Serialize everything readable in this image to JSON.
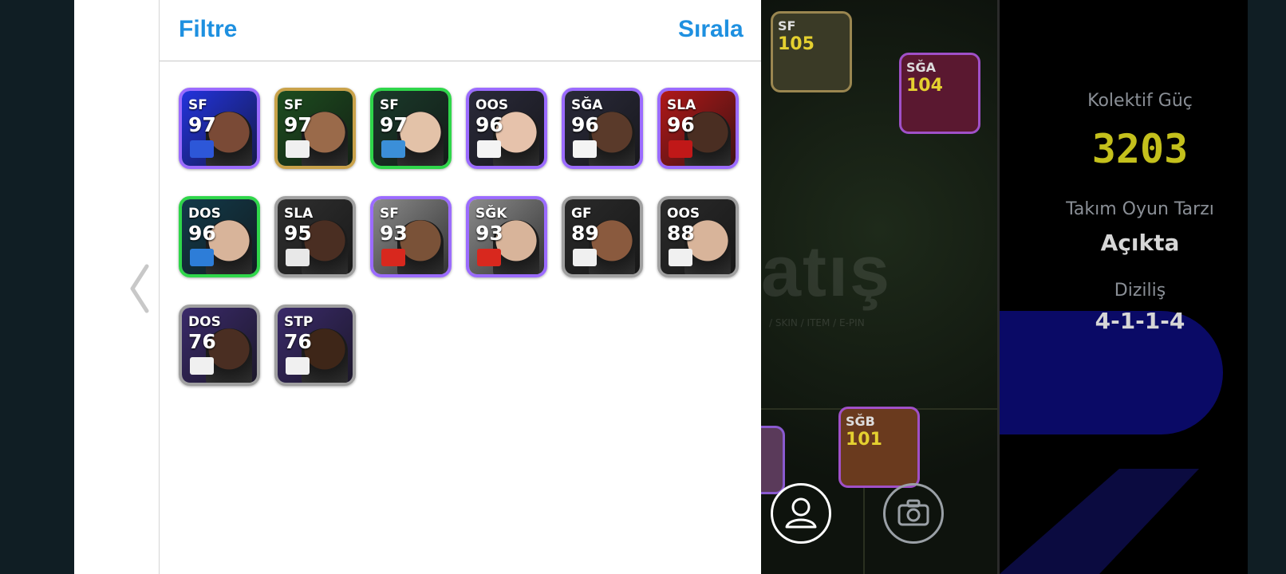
{
  "header": {
    "filter_label": "Filtre",
    "sort_label": "Sırala"
  },
  "cards": [
    {
      "pos": "SF",
      "rating": "97",
      "border": "#9b6bff",
      "bg": "#2233dd",
      "skin": "#7a4a36",
      "badge": "#2d57d8"
    },
    {
      "pos": "SF",
      "rating": "97",
      "border": "#c9a24a",
      "bg": "#1d4d1f",
      "skin": "#9a6a4a",
      "badge": "#f0f0f0"
    },
    {
      "pos": "SF",
      "rating": "97",
      "border": "#2fd64a",
      "bg": "#1a3a2a",
      "skin": "#e3c2a8",
      "badge": "#3b8fd8"
    },
    {
      "pos": "OOS",
      "rating": "96",
      "border": "#9b6bff",
      "bg": "#2a2a3a",
      "skin": "#e6c2ab",
      "badge": "#f4f4f4"
    },
    {
      "pos": "SĞA",
      "rating": "96",
      "border": "#9b6bff",
      "bg": "#2a2a3a",
      "skin": "#5a3a2a",
      "badge": "#f4f4f4"
    },
    {
      "pos": "SLA",
      "rating": "96",
      "border": "#9b6bff",
      "bg": "#b01818",
      "skin": "#4a2e22",
      "badge": "#c01818"
    },
    {
      "pos": "DOS",
      "rating": "96",
      "border": "#2fd64a",
      "bg": "#123a4a",
      "skin": "#d8b49a",
      "badge": "#2d7dd8"
    },
    {
      "pos": "SLA",
      "rating": "95",
      "border": "#a0a0a0",
      "bg": "#2f2f2f",
      "skin": "#4a2e22",
      "badge": "#e8e8e8"
    },
    {
      "pos": "SF",
      "rating": "93",
      "border": "#9b6bff",
      "bg": "#8a8a8a",
      "skin": "#7a5238",
      "badge": "#d8281e"
    },
    {
      "pos": "SĞK",
      "rating": "93",
      "border": "#9b6bff",
      "bg": "#8a8a8a",
      "skin": "#d8b49a",
      "badge": "#d8281e"
    },
    {
      "pos": "GF",
      "rating": "89",
      "border": "#a0a0a0",
      "bg": "#2a2a2a",
      "skin": "#8a5a3e",
      "badge": "#f0f0f0"
    },
    {
      "pos": "OOS",
      "rating": "88",
      "border": "#a0a0a0",
      "bg": "#2a2a2a",
      "skin": "#d8b49a",
      "badge": "#f0f0f0"
    },
    {
      "pos": "DOS",
      "rating": "76",
      "border": "#a0a0a0",
      "bg": "#3a2a6a",
      "skin": "#4a2e22",
      "badge": "#f0f0f0"
    },
    {
      "pos": "STP",
      "rating": "76",
      "border": "#a0a0a0",
      "bg": "#3a2a6a",
      "skin": "#3e2618",
      "badge": "#f0f0f0"
    }
  ],
  "watermark": {
    "logo_text": "atış",
    "sub_text": "/ SKIN / ITEM / E-PIN"
  },
  "team": {
    "power_label": "Kolektif Güç",
    "power_value": "3203",
    "style_label": "Takım Oyun Tarzı",
    "style_value": "Açıkta",
    "formation_label": "Diziliş",
    "formation_value": "4-1-1-4"
  },
  "field_players": [
    {
      "pos": "SF",
      "rating": "105",
      "border": "#9a8650"
    },
    {
      "pos": "SĞA",
      "rating": "104",
      "border": "#a050c8"
    },
    {
      "pos": "SĞB",
      "rating": "101",
      "border": "#a050c8"
    }
  ],
  "colors": {
    "accent": "#1e90e0",
    "power": "#c4c01c"
  }
}
